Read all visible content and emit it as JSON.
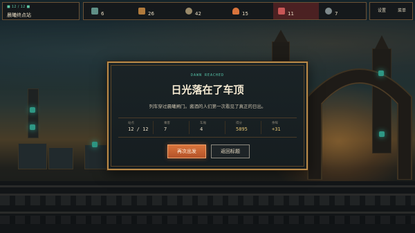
{
  "hud": {
    "stage": {
      "subtitle": "■ 12 / 12 ■",
      "title": "晨曦终点站"
    },
    "resources": [
      {
        "icon": "crystal-icon",
        "value": "6",
        "color": "#5f8f86"
      },
      {
        "icon": "ore-icon",
        "value": "26",
        "color": "#b07a3c"
      },
      {
        "icon": "gear-icon",
        "value": "42",
        "color": "#9a8a6a"
      },
      {
        "icon": "fire-icon",
        "value": "15",
        "color": "#d9743c"
      },
      {
        "icon": "heart-icon",
        "value": "11",
        "color": "#c85656",
        "warn": true
      },
      {
        "icon": "clock-icon",
        "value": "7",
        "color": "#7f8a8c"
      }
    ],
    "buttons": {
      "settings": "设置",
      "menu": "菜单"
    }
  },
  "dialog": {
    "kicker": "DAWN REACHED",
    "title": "日光落在了车顶",
    "description": "列车穿过晨曦闸门。酱酒的人们第一次看见了真正的日出。",
    "stats": [
      {
        "label": "站点",
        "value": "12 / 12"
      },
      {
        "label": "乘客",
        "value": "7"
      },
      {
        "label": "车厢",
        "value": "4"
      },
      {
        "label": "得分",
        "value": "5895",
        "highlight": true
      },
      {
        "label": "余晖",
        "value": "+31",
        "highlight": true
      }
    ],
    "primary_button": "再次出发",
    "secondary_button": "返回标题"
  }
}
